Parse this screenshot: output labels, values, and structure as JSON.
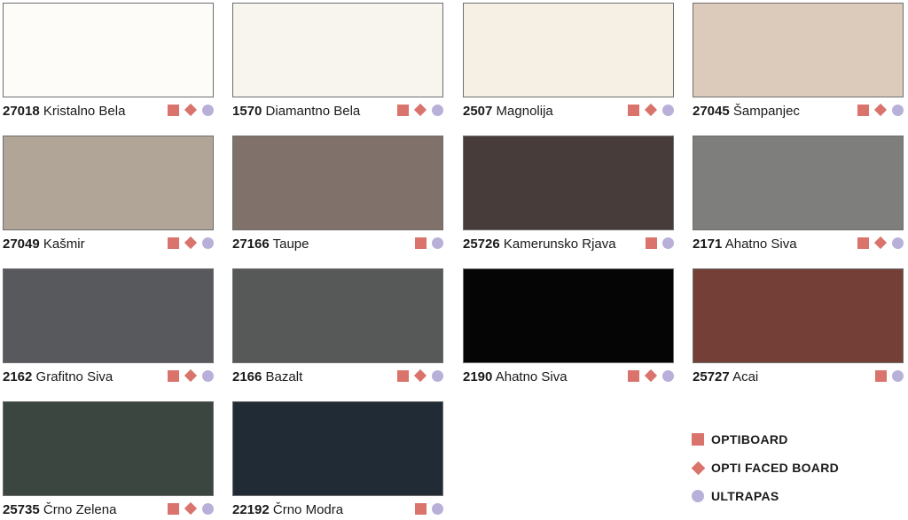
{
  "swatches": [
    {
      "code": "27018",
      "name": "Kristalno Bela",
      "color": "#fdfcf8",
      "marks": [
        "square",
        "diamond",
        "circle"
      ]
    },
    {
      "code": "1570",
      "name": "Diamantno Bela",
      "color": "#f7f5ee",
      "marks": [
        "square",
        "diamond",
        "circle"
      ]
    },
    {
      "code": "2507",
      "name": "Magnolija",
      "color": "#f6f0e4",
      "marks": [
        "square",
        "diamond",
        "circle"
      ]
    },
    {
      "code": "27045",
      "name": "Šampanjec",
      "color": "#dccbbb",
      "marks": [
        "square",
        "diamond",
        "circle"
      ]
    },
    {
      "code": "27049",
      "name": "Kašmir",
      "color": "#b0a596",
      "marks": [
        "square",
        "diamond",
        "circle"
      ]
    },
    {
      "code": "27166",
      "name": "Taupe",
      "color": "#80716a",
      "marks": [
        "square",
        "circle"
      ]
    },
    {
      "code": "25726",
      "name": "Kamerunsko Rjava",
      "color": "#473c3a",
      "marks": [
        "square",
        "circle"
      ]
    },
    {
      "code": "2171",
      "name": "Ahatno Siva",
      "color": "#7e7e7c",
      "marks": [
        "square",
        "diamond",
        "circle"
      ]
    },
    {
      "code": "2162",
      "name": "Grafitno Siva",
      "color": "#58595c",
      "marks": [
        "square",
        "diamond",
        "circle"
      ]
    },
    {
      "code": "2166",
      "name": "Bazalt",
      "color": "#575958",
      "marks": [
        "square",
        "diamond",
        "circle"
      ]
    },
    {
      "code": "2190",
      "name": "Ahatno Siva",
      "color": "#050505",
      "marks": [
        "square",
        "diamond",
        "circle"
      ]
    },
    {
      "code": "25727",
      "name": "Acai",
      "color": "#733f36",
      "marks": [
        "square",
        "circle"
      ]
    },
    {
      "code": "25735",
      "name": "Črno Zelena",
      "color": "#3b4641",
      "marks": [
        "square",
        "diamond",
        "circle"
      ]
    },
    {
      "code": "22192",
      "name": "Črno Modra",
      "color": "#212b35",
      "marks": [
        "square",
        "circle"
      ]
    }
  ],
  "legend": [
    {
      "mark": "square",
      "label": "OPTIBOARD"
    },
    {
      "mark": "diamond",
      "label": "OPTI FACED BOARD"
    },
    {
      "mark": "circle",
      "label": "ULTRAPAS"
    }
  ],
  "colors": {
    "square": "#d9736b",
    "diamond": "#d9736b",
    "circle": "#b8b0d8"
  }
}
